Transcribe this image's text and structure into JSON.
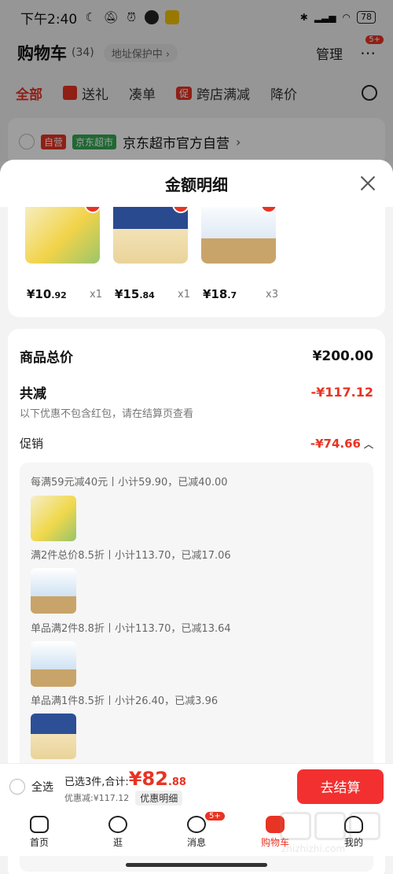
{
  "status_bar": {
    "time": "下午2:40",
    "battery": "78"
  },
  "cart": {
    "title": "购物车",
    "count": "(34)",
    "address_label": "地址保护中",
    "manage_label": "管理",
    "more_badge": "5+",
    "tabs": [
      {
        "label": "全部",
        "active": true
      },
      {
        "label": "送礼"
      },
      {
        "label": "凑单"
      },
      {
        "label": "跨店满减",
        "badge": "促"
      },
      {
        "label": "降价"
      }
    ]
  },
  "shop": {
    "tag_self": "自营",
    "tag_market": "京东超市",
    "name": "京东超市官方自营"
  },
  "sheet": {
    "title": "金额明细",
    "products": [
      {
        "price_int": "¥10",
        "price_dec": ".92",
        "qty": "x1",
        "color": "#f2d34a"
      },
      {
        "price_int": "¥15",
        "price_dec": ".84",
        "qty": "x1",
        "color": "#2a4a8f"
      },
      {
        "price_int": "¥18",
        "price_dec": ".7",
        "qty": "x3",
        "color": "#dfe9f5"
      }
    ],
    "goods_total_label": "商品总价",
    "goods_total_value": "¥200.00",
    "reduce_label": "共减",
    "reduce_value": "-¥117.12",
    "reduce_note": "以下优惠不包含红包，请在结算页查看",
    "promo_label": "促销",
    "promo_value": "-¥74.66",
    "promos": [
      {
        "text": "每满59元减40元丨小计59.90，已减40.00",
        "thumb_color": "#f0d84c"
      },
      {
        "text": "满2件总价8.5折丨小计113.70，已减17.06",
        "thumb_color": "#cfe2f3"
      },
      {
        "text": "单品满2件8.8折丨小计113.70，已减13.64",
        "thumb_color": "#cfe2f3"
      },
      {
        "text": "单品满1件8.5折丨小计26.40，已减3.96",
        "thumb_color": "#2d4f96"
      }
    ]
  },
  "checkout": {
    "select_all": "全选",
    "selected_prefix": "已选3件,合计:",
    "total_int": "¥82",
    "total_dec": ".88",
    "discount_text": "优惠减:¥117.12",
    "detail_button": "优惠明细",
    "submit_button": "去结算"
  },
  "nav": [
    {
      "label": "首页"
    },
    {
      "label": "逛"
    },
    {
      "label": "消息",
      "badge": "5+"
    },
    {
      "label": "购物车",
      "active": true
    },
    {
      "label": "我的"
    }
  ],
  "watermark": "zhizhizhi.com"
}
